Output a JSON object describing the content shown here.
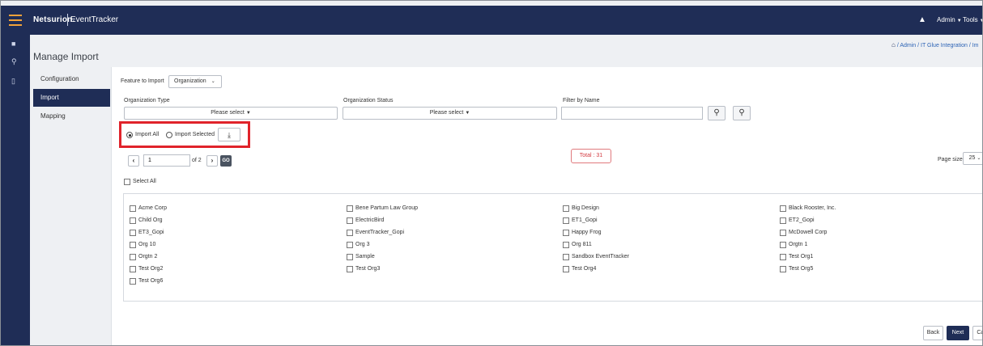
{
  "topbar": {
    "brand": "Netsurion.",
    "product": "EventTracker",
    "menus": [
      "Admin",
      "Tools"
    ]
  },
  "breadcrumb": "/ Admin / IT Glue Integration / Im",
  "page_title": "Manage Import",
  "subnav": [
    {
      "label": "Configuration",
      "active": false
    },
    {
      "label": "Import",
      "active": true
    },
    {
      "label": "Mapping",
      "active": false
    }
  ],
  "feature": {
    "label": "Feature to Import",
    "value": "Organization"
  },
  "filters": {
    "org_type_label": "Organization Type",
    "org_type_value": "Please select",
    "org_status_label": "Organization Status",
    "org_status_value": "Please select",
    "name_label": "Filter by Name"
  },
  "import_options": {
    "all_label": "Import All",
    "selected_label": "Import Selected",
    "selected": "all"
  },
  "pager": {
    "page": "1",
    "of_text": "of 2",
    "go": "GO"
  },
  "total": "Total : 31",
  "page_size": {
    "label": "Page size",
    "value": "25"
  },
  "select_all": "Select All",
  "organizations": [
    [
      "Acme Corp",
      "Bene Partum Law Group",
      "Big Design",
      "Black Rooster, Inc."
    ],
    [
      "Child Org",
      "ElectricBird",
      "ET1_Gopi",
      "ET2_Gopi"
    ],
    [
      "ET3_Gopi",
      "EventTracker_Gopi",
      "Happy Frog",
      "McDowell Corp"
    ],
    [
      "Org 10",
      "Org 3",
      "Org 811",
      "Orgtn 1"
    ],
    [
      "Orgtn 2",
      "Sample",
      "Sandbox EventTracker",
      "Test Org1"
    ],
    [
      "Test Org2",
      "Test Org3",
      "Test Org4",
      "Test Org5"
    ],
    [
      "Test Org6"
    ]
  ],
  "footer": {
    "back": "Back",
    "next": "Next",
    "cancel": "Car"
  },
  "colors": {
    "navy": "#1f2d56",
    "highlight": "#e0232b",
    "total": "#d33b41",
    "link": "#2c63b5"
  }
}
